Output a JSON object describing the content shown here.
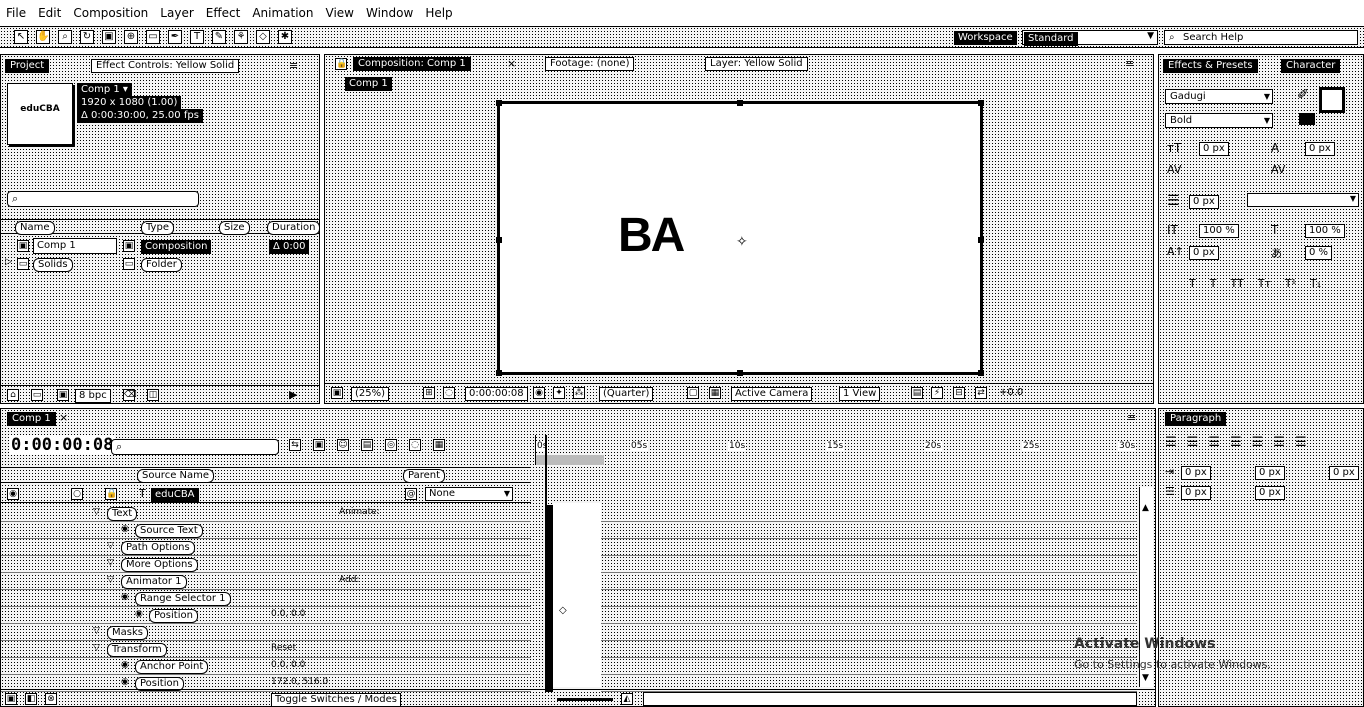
{
  "menu": [
    "File",
    "Edit",
    "Composition",
    "Layer",
    "Effect",
    "Animation",
    "View",
    "Window",
    "Help"
  ],
  "toolbar": {
    "workspace_label": "Workspace",
    "workspace_value": "Standard",
    "search_placeholder": "Search Help"
  },
  "project": {
    "tabs": [
      "Project",
      "Effect Controls: Yellow Solid"
    ],
    "thumb_text": "eduCBA",
    "comp_name": "Comp 1 ▾",
    "comp_size": "1920 x 1080 (1.00)",
    "comp_duration": "Δ 0:00:30:00, 25.00 fps",
    "columns": [
      "Name",
      "Type",
      "Size",
      "Duration"
    ],
    "items": [
      {
        "name": "Comp 1",
        "type": "Composition",
        "duration": "Δ 0:00"
      },
      {
        "name": "Solids",
        "type": "Folder",
        "duration": ""
      }
    ],
    "bpc": "8 bpc"
  },
  "viewer": {
    "tabs": [
      "Composition: Comp 1",
      "Footage: (none)",
      "Layer: Yellow Solid"
    ],
    "sub_tab": "Comp 1",
    "canvas_text": "BA",
    "zoom": "(25%)",
    "timecode": "0:00:00:08",
    "quality": "(Quarter)",
    "camera": "Active Camera",
    "view": "1 View",
    "exposure": "+0.0"
  },
  "right": {
    "tabs": [
      "Effects & Presets",
      "Character"
    ],
    "font_family": "Gadugi",
    "font_style": "Bold",
    "paragraph_tab": "Paragraph",
    "px_values": [
      "0 px",
      "0 px",
      "0 px",
      "0 px",
      "0 px",
      "0 px"
    ],
    "percents": [
      "100 %",
      "100 %",
      "0 %",
      "0 %"
    ]
  },
  "timeline": {
    "tab": "Comp 1",
    "timecode": "0:00:00:08",
    "columns": [
      "Source Name",
      "Parent"
    ],
    "layer": {
      "name": "eduCBA",
      "parent": "None"
    },
    "ruler": [
      "0s",
      "05s",
      "10s",
      "15s",
      "20s",
      "25s",
      "30s"
    ],
    "rows": [
      {
        "label": "Text",
        "indent": 1,
        "extra": "Animate:"
      },
      {
        "label": "Source Text",
        "indent": 3,
        "extra": ""
      },
      {
        "label": "Path Options",
        "indent": 2,
        "extra": ""
      },
      {
        "label": "More Options",
        "indent": 2,
        "extra": ""
      },
      {
        "label": "Animator 1",
        "indent": 2,
        "extra": "Add:"
      },
      {
        "label": "Range Selector 1",
        "indent": 3,
        "extra": ""
      },
      {
        "label": "Position",
        "indent": 4,
        "extra": "0.0, 0.0"
      },
      {
        "label": "Masks",
        "indent": 1,
        "extra": ""
      },
      {
        "label": "Transform",
        "indent": 1,
        "extra": "Reset"
      },
      {
        "label": "Anchor Point",
        "indent": 3,
        "extra": "0.0, 0.0"
      },
      {
        "label": "Position",
        "indent": 3,
        "extra": "172.0, 516.0"
      }
    ],
    "toggle_label": "Toggle Switches / Modes"
  },
  "watermark": {
    "title": "Activate Windows",
    "subtitle": "Go to Settings to activate Windows."
  },
  "colors": {
    "ink": "#000000",
    "paper": "#ffffff",
    "dither": "#f4f4f4"
  }
}
